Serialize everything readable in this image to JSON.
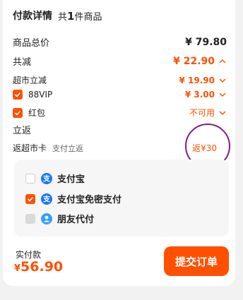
{
  "header": {
    "title": "付款详情",
    "count_prefix": "共",
    "count": "1",
    "count_suffix": "件商品"
  },
  "rows": {
    "total": {
      "label": "商品总价",
      "value": "¥ 79.80"
    },
    "reduce": {
      "label": "共减",
      "value": "¥ 22.90"
    },
    "market": {
      "label": "超市立减",
      "value": "¥ 19.90"
    },
    "vip": {
      "label": "88VIP",
      "value": "¥ 3.00"
    },
    "hongbao": {
      "label": "红包",
      "value": "不可用"
    },
    "lifan": {
      "label": "立返"
    },
    "card": {
      "label": "返超市卡",
      "sub": "支付立返",
      "value": "返¥30"
    }
  },
  "payment": {
    "options": [
      {
        "label": "支付宝",
        "state": "unchecked"
      },
      {
        "label": "支付宝免密支付",
        "state": "checked"
      },
      {
        "label": "朋友代付",
        "state": "disabled"
      }
    ]
  },
  "footer": {
    "paid_label": "实付款",
    "currency": "¥",
    "amount": "56.90",
    "submit_label": "提交订单"
  },
  "colors": {
    "accent": "#ff5000",
    "alipay": "#1677ff",
    "annotation": "#8a1a7f"
  },
  "icons": {
    "checkbox": "checkmark-icon",
    "expand": "chevron-icon",
    "alipay": "alipay-icon",
    "friend": "friend-pay-icon"
  }
}
